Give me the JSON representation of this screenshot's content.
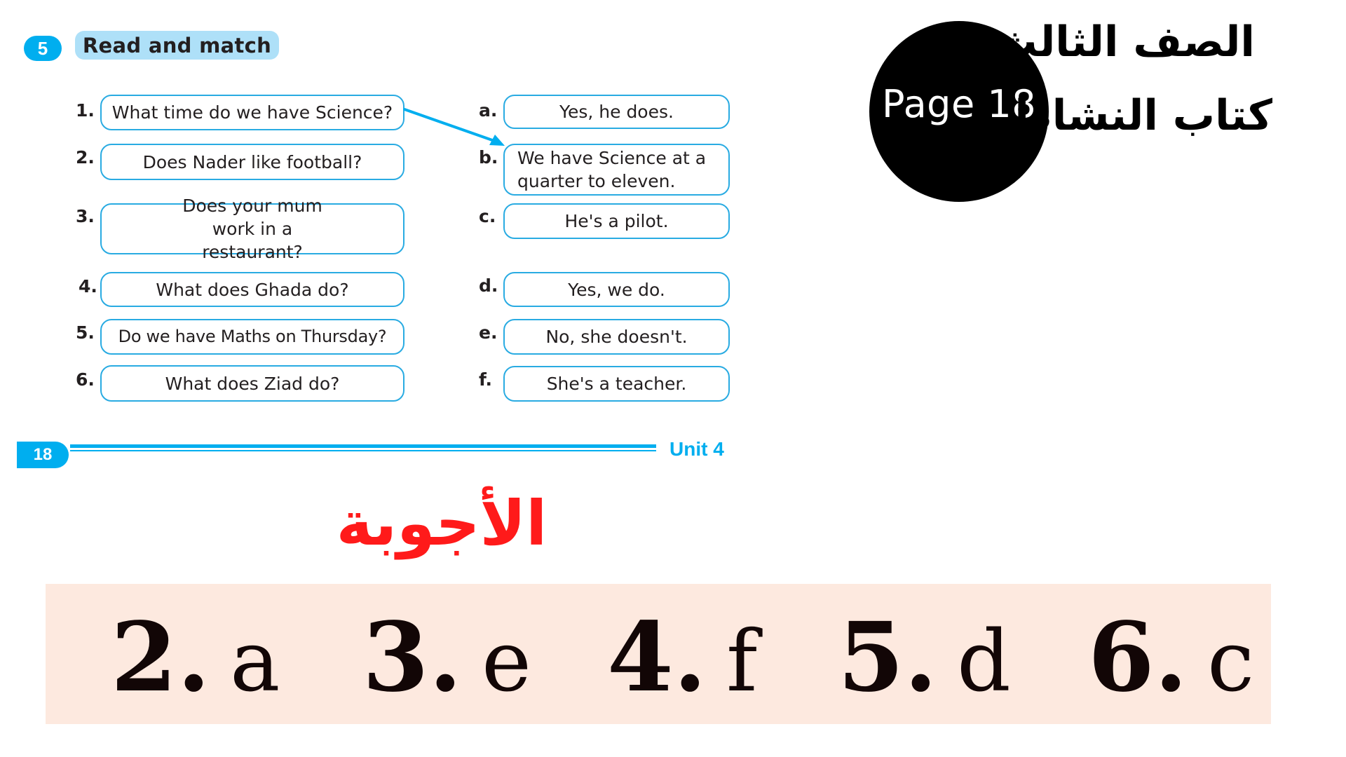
{
  "exercise": {
    "number": "5",
    "title": "Read and match"
  },
  "questions": [
    {
      "num": "1.",
      "text": "What time do we have Science?"
    },
    {
      "num": "2.",
      "text": "Does Nader like football?"
    },
    {
      "num": "3.",
      "text": "Does your mum work in a restaurant?"
    },
    {
      "num": "4.",
      "text": "What does Ghada do?"
    },
    {
      "num": "5.",
      "text": "Do we have Maths on Thursday?"
    },
    {
      "num": "6.",
      "text": "What does Ziad do?"
    }
  ],
  "responses": [
    {
      "letter": "a.",
      "text": "Yes, he does."
    },
    {
      "letter": "b.",
      "text": "We have Science at a quarter to eleven."
    },
    {
      "letter": "c.",
      "text": "He's a pilot."
    },
    {
      "letter": "d.",
      "text": "Yes, we do."
    },
    {
      "letter": "e.",
      "text": "No, she doesn't."
    },
    {
      "letter": "f.",
      "text": "She's a teacher."
    }
  ],
  "example_match": {
    "from": "1",
    "to": "b"
  },
  "footer": {
    "page_number": "18",
    "unit": "Unit 4"
  },
  "overlay": {
    "page_label": "Page 18",
    "grade": "الصف الثالث",
    "book": "كتاب النشاط",
    "answers_title": "الأجوبة"
  },
  "answers": [
    {
      "num": "2.",
      "letter": "a"
    },
    {
      "num": "3.",
      "letter": "e"
    },
    {
      "num": "4.",
      "letter": "f"
    },
    {
      "num": "5.",
      "letter": "d"
    },
    {
      "num": "6.",
      "letter": "c"
    }
  ],
  "colors": {
    "accent_blue": "#00aeef",
    "title_pill": "#aee0f8",
    "answers_title": "#ff1a1a",
    "answer_band": "#fde9df"
  }
}
